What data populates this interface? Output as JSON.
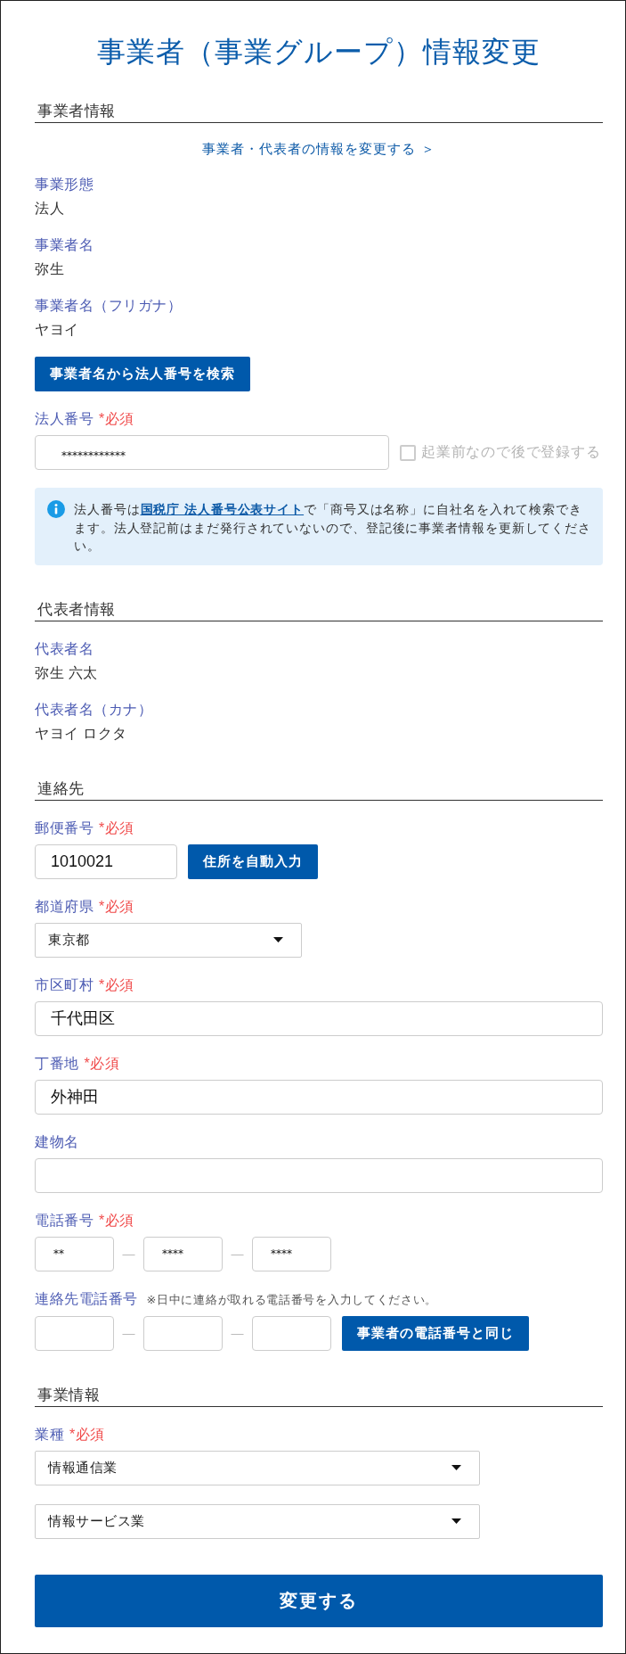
{
  "title": "事業者（事業グループ）情報変更",
  "sections": [
    {
      "heading": "事業者情報",
      "items": [
        {
          "kind": "link",
          "text": "事業者・代表者の情報を変更する ＞"
        },
        {
          "kind": "readonly",
          "label": "事業形態",
          "value": "法人"
        },
        {
          "kind": "readonly",
          "label": "事業者名",
          "value": "弥生"
        },
        {
          "kind": "readonly",
          "label": "事業者名（フリガナ）",
          "value": "ヤヨイ"
        },
        {
          "kind": "button",
          "text": "事業者名から法人番号を検索"
        },
        {
          "kind": "masked_input",
          "label": "法人番号",
          "required": "*必須",
          "value": "************",
          "checkbox": {
            "label": "起業前なので後で登録する",
            "checked": false,
            "disabled": true
          }
        },
        {
          "kind": "info",
          "before": "法人番号は",
          "link": "国税庁 法人番号公表サイト",
          "after": "で「商号又は名称」に自社名を入れて検索できます。法人登記前はまだ発行されていないので、登記後に事業者情報を更新してください。"
        }
      ]
    },
    {
      "heading": "代表者情報",
      "items": [
        {
          "kind": "readonly",
          "label": "代表者名",
          "value": "弥生 六太"
        },
        {
          "kind": "readonly",
          "label": "代表者名（カナ）",
          "value": "ヤヨイ ロクタ"
        }
      ]
    },
    {
      "heading": "連絡先",
      "items": [
        {
          "kind": "postal",
          "label": "郵便番号",
          "required": "*必須",
          "value": "1010021",
          "button": "住所を自動入力"
        },
        {
          "kind": "select",
          "label": "都道府県",
          "required": "*必須",
          "value": "東京都"
        },
        {
          "kind": "input",
          "label": "市区町村",
          "required": "*必須",
          "value": "千代田区"
        },
        {
          "kind": "input",
          "label": "丁番地",
          "required": "*必須",
          "value": "外神田"
        },
        {
          "kind": "input",
          "label": "建物名"
        },
        {
          "kind": "phone",
          "label": "電話番号",
          "required": "*必須",
          "parts": [
            {
              "kind": "input",
              "value": "**"
            },
            {
              "kind": "separator",
              "text": "—"
            },
            {
              "kind": "input",
              "value": "****"
            },
            {
              "kind": "separator",
              "text": "—"
            },
            {
              "kind": "input",
              "value": "****"
            }
          ]
        },
        {
          "kind": "phone",
          "label": "連絡先電話番号",
          "note": "※日中に連絡が取れる電話番号を入力してください。",
          "parts": [
            {
              "kind": "input"
            },
            {
              "kind": "separator",
              "text": "—"
            },
            {
              "kind": "input"
            },
            {
              "kind": "separator",
              "text": "—"
            },
            {
              "kind": "input"
            }
          ],
          "button": "事業者の電話番号と同じ"
        }
      ]
    },
    {
      "heading": "事業情報",
      "items": [
        {
          "kind": "select_stack",
          "label": "業種",
          "required": "*必須",
          "values": [
            "情報通信業",
            "情報サービス業"
          ]
        }
      ]
    }
  ],
  "submit": "変更する"
}
